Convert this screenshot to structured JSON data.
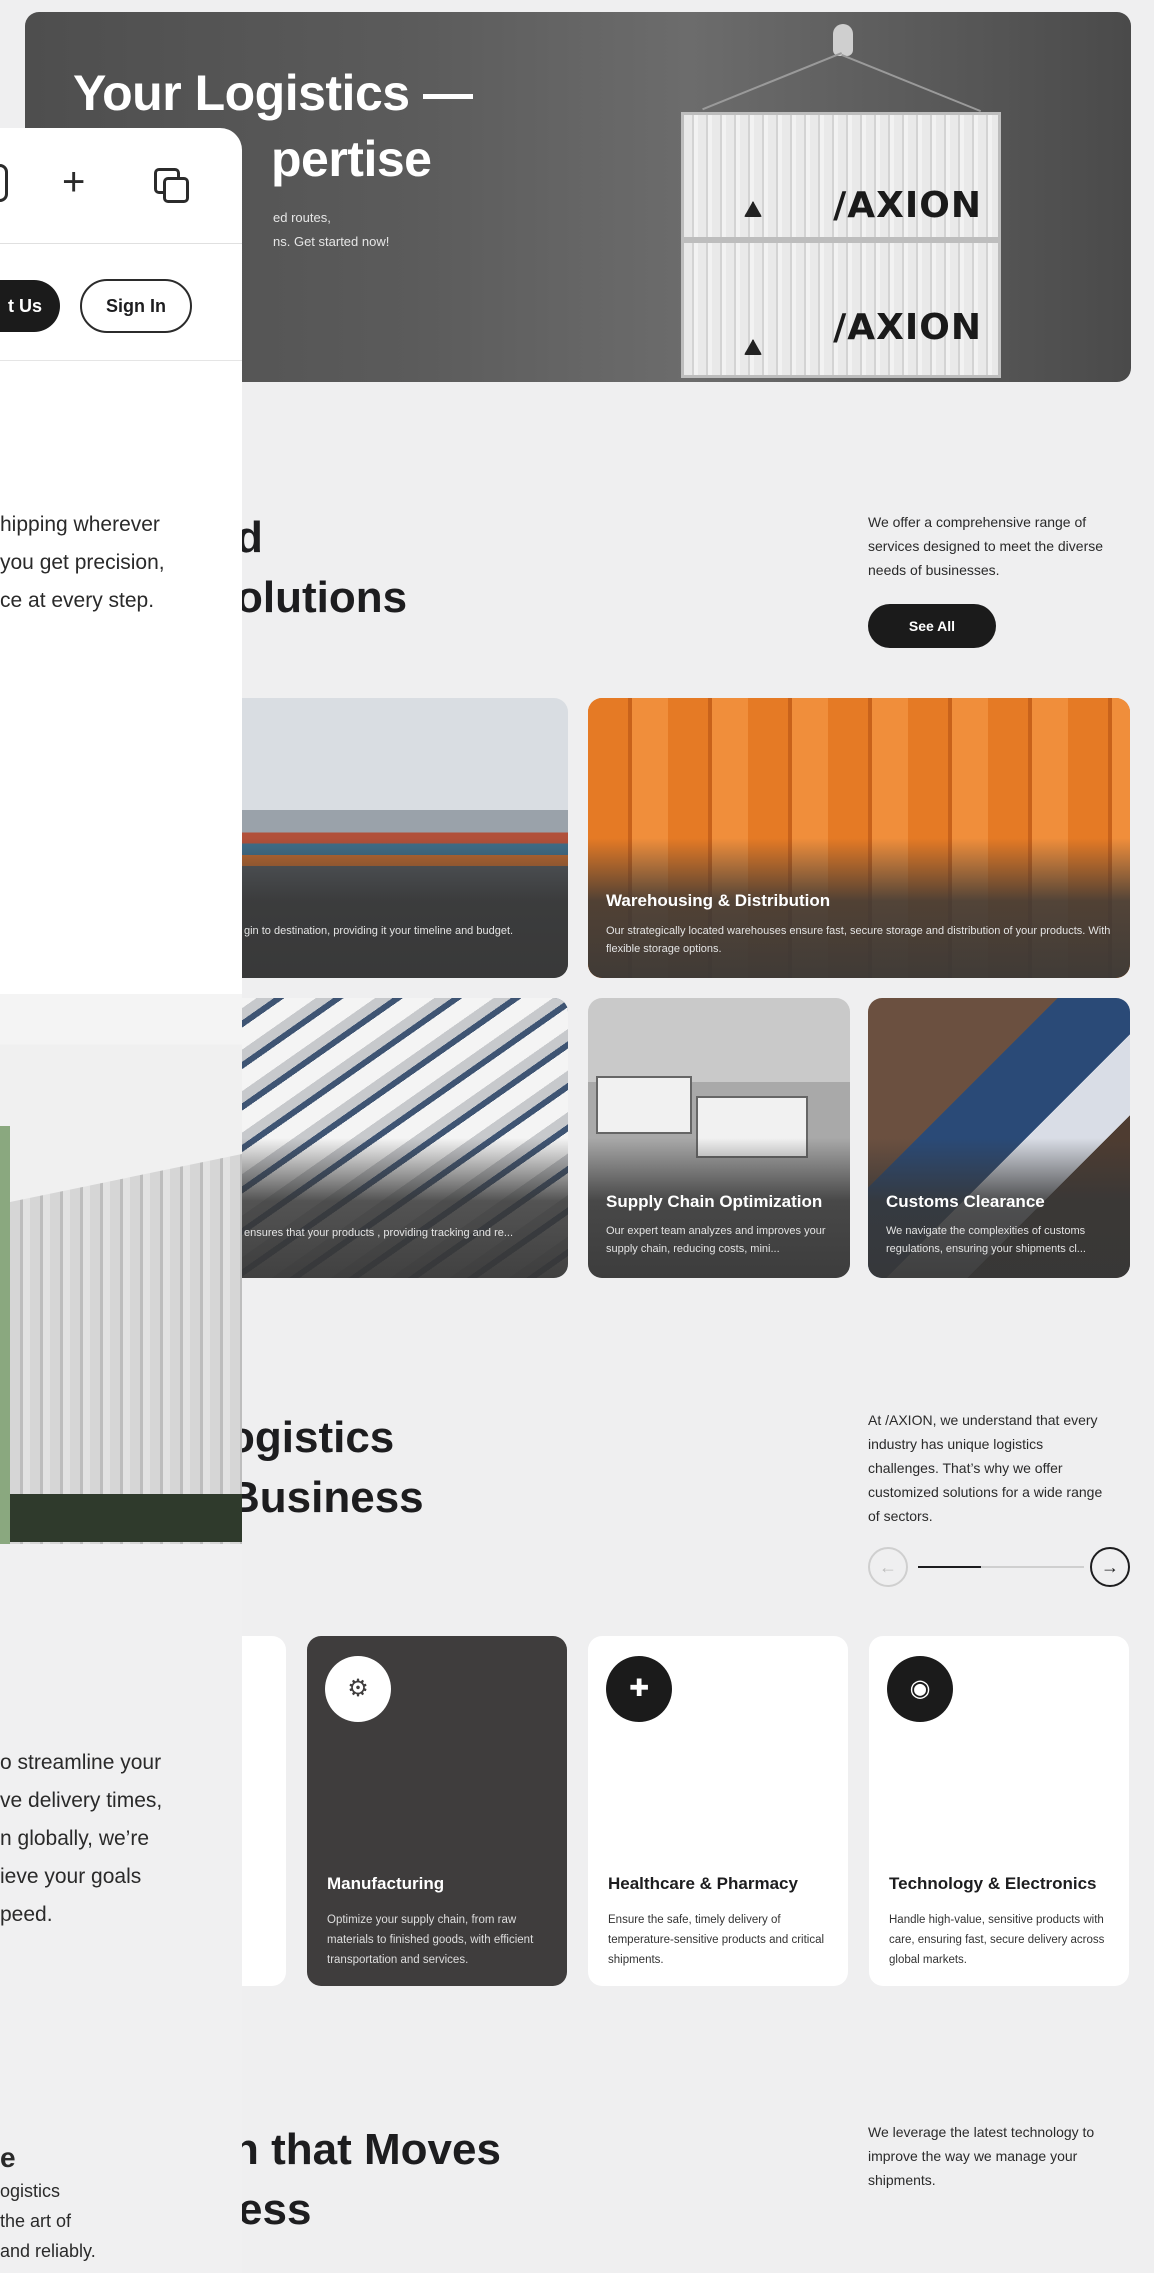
{
  "hero": {
    "title": "Your Logistics — Expertise",
    "title_line1": "Your Logistics —",
    "title_line2": "pertise",
    "desc_line1": "ed routes,",
    "desc_line2": "ns. Get started now!",
    "container_brand": "/AXION"
  },
  "browser_panel": {
    "contact_label": "t Us",
    "signin_label": "Sign In",
    "intro_lines": [
      "hipping wherever",
      "you get precision,",
      "ce at every step."
    ],
    "industries_lines": [
      "o streamline your",
      "ve delivery times,",
      "n globally, we’re",
      "ieve your goals",
      "peed."
    ],
    "bottom_lines": [
      "e",
      "ogistics",
      "the art of",
      "and reliably."
    ]
  },
  "services": {
    "heading_line1": "d",
    "heading_line2": "olutions",
    "side_text": "We offer a comprehensive range of services designed to meet the diverse needs of businesses.",
    "see_all_label": "See All",
    "cards": [
      {
        "title": "",
        "desc": "gin to destination, providing it your timeline and budget."
      },
      {
        "title": "Warehousing & Distribution",
        "desc": "Our strategically located warehouses ensure fast, secure storage and distribution of your products. With flexible storage options."
      },
      {
        "title": "",
        "desc": "ensures that your products , providing tracking and re..."
      },
      {
        "title": "Supply Chain Optimization",
        "desc": "Our expert team analyzes and improves your supply chain, reducing costs, mini..."
      },
      {
        "title": "Customs Clearance",
        "desc": "We navigate the complexities of customs regulations, ensuring your shipments cl..."
      }
    ]
  },
  "industries": {
    "heading_line1": "ogistics",
    "heading_line2": "Business",
    "side_text": "At /AXION, we understand that every industry has unique logistics challenges. That’s why we offer customized solutions for a wide range of sectors.",
    "slider_progress": 0.38,
    "prev_icon": "←",
    "next_icon": "→",
    "cards": [
      {
        "title": "Manufacturing",
        "desc": "Optimize your supply chain, from raw materials to finished goods, with efficient transportation and services.",
        "icon": "⚙"
      },
      {
        "title": "Healthcare & Pharmacy",
        "desc": "Ensure the safe, timely delivery of temperature-sensitive products and critical shipments.",
        "icon": "✚"
      },
      {
        "title": "Technology & Electronics",
        "desc": "Handle high-value, sensitive products with care, ensuring fast, secure delivery across global markets.",
        "icon": "◉"
      }
    ]
  },
  "tech": {
    "heading_line1": "n that Moves",
    "heading_line2": "ess",
    "side_text": "We leverage the latest technology to improve the way we manage your shipments."
  }
}
